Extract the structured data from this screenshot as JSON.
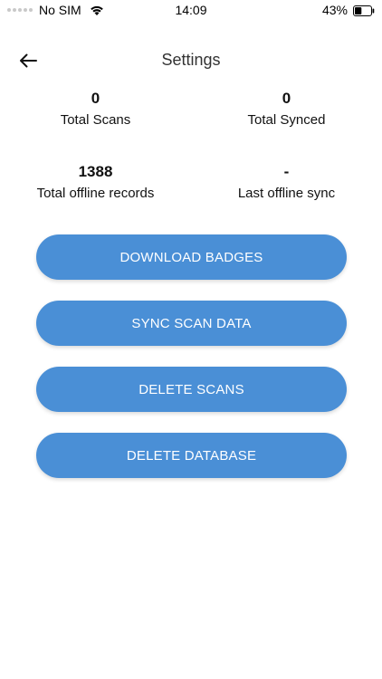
{
  "status_bar": {
    "carrier": "No SIM",
    "time": "14:09",
    "battery_percent": "43%",
    "battery_level": 0.43,
    "icons": [
      "signal-icon",
      "wifi-icon",
      "battery-icon"
    ]
  },
  "header": {
    "title": "Settings",
    "back_icon": "arrow-left-icon"
  },
  "stats": [
    {
      "value": "0",
      "label": "Total Scans"
    },
    {
      "value": "0",
      "label": "Total Synced"
    },
    {
      "value": "1388",
      "label": "Total offline records"
    },
    {
      "value": "-",
      "label": "Last offline sync"
    }
  ],
  "actions": {
    "download_badges": "DOWNLOAD BADGES",
    "sync_scan_data": "SYNC SCAN DATA",
    "delete_scans": "DELETE SCANS",
    "delete_database": "DELETE DATABASE"
  },
  "colors": {
    "button": "#4a8fd6",
    "button_text": "#ffffff",
    "background": "#ffffff",
    "title": "#333333"
  }
}
